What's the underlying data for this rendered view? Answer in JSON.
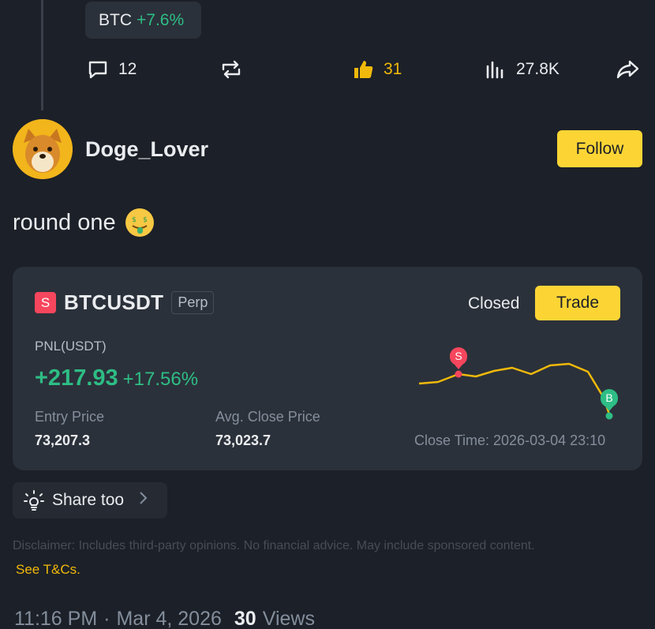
{
  "tag": {
    "symbol": "BTC",
    "change": "+7.6%"
  },
  "actions": {
    "comments": "12",
    "likes": "31",
    "views": "27.8K"
  },
  "author": {
    "name": "Doge_Lover",
    "follow_label": "Follow"
  },
  "post": {
    "text": "round one"
  },
  "trade_card": {
    "side": "S",
    "symbol": "BTCUSDT",
    "contract_type": "Perp",
    "status": "Closed",
    "trade_label": "Trade",
    "pnl_label": "PNL(USDT)",
    "pnl_value": "+217.93",
    "pnl_percent": "+17.56%",
    "entry_price_label": "Entry Price",
    "entry_price": "73,207.3",
    "avg_close_label": "Avg. Close Price",
    "avg_close_price": "73,023.7",
    "close_time": "Close Time: 2026-03-04 23:10",
    "markers": {
      "sell": "S",
      "buy": "B"
    },
    "colors": {
      "line": "#f0b90b",
      "sell": "#f6465d",
      "buy": "#2ebd85"
    }
  },
  "share": {
    "label": "Share too"
  },
  "disclaimer": {
    "text": "Disclaimer: Includes third-party opinions. No financial advice. May include sponsored content.",
    "link": "See T&Cs."
  },
  "footer": {
    "time": "11:16 PM",
    "date": "Mar 4, 2026",
    "views_count": "30",
    "views_label": "Views"
  }
}
